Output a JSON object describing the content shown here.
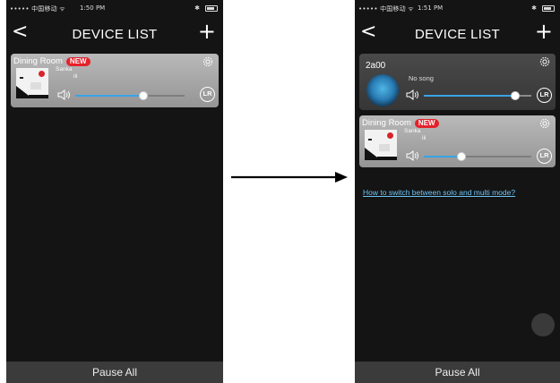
{
  "left_screen": {
    "status": {
      "carrier": "••••• 中国移动 ᯤ",
      "time": "1:50 PM",
      "bt": "✱"
    },
    "nav": {
      "back": "<",
      "title": "DEVICE LIST",
      "add": "+"
    },
    "devices": [
      {
        "room": "Dining Room",
        "badge": "NEW",
        "song_line1": "Sanka",
        "song_line2": "ili",
        "volume": 0.62,
        "lr": "LR"
      }
    ],
    "footer": "Pause All"
  },
  "right_screen": {
    "status": {
      "carrier": "••••• 中国移动 ᯤ",
      "time": "1:51 PM",
      "bt": "✱"
    },
    "nav": {
      "back": "<",
      "title": "DEVICE LIST",
      "add": "+"
    },
    "devices": [
      {
        "name": "2a00",
        "song": "No song",
        "volume": 0.85,
        "lr": "LR"
      },
      {
        "room": "Dining Room",
        "badge": "NEW",
        "song_line1": "Sanka",
        "song_line2": "ili",
        "volume": 0.35,
        "lr": "LR"
      }
    ],
    "help_link": "How to switch between solo and multi mode?",
    "footer": "Pause All"
  },
  "colors": {
    "accent": "#38a3e6",
    "badge": "#e5202a",
    "link": "#6cc4f5",
    "background": "#141414"
  }
}
